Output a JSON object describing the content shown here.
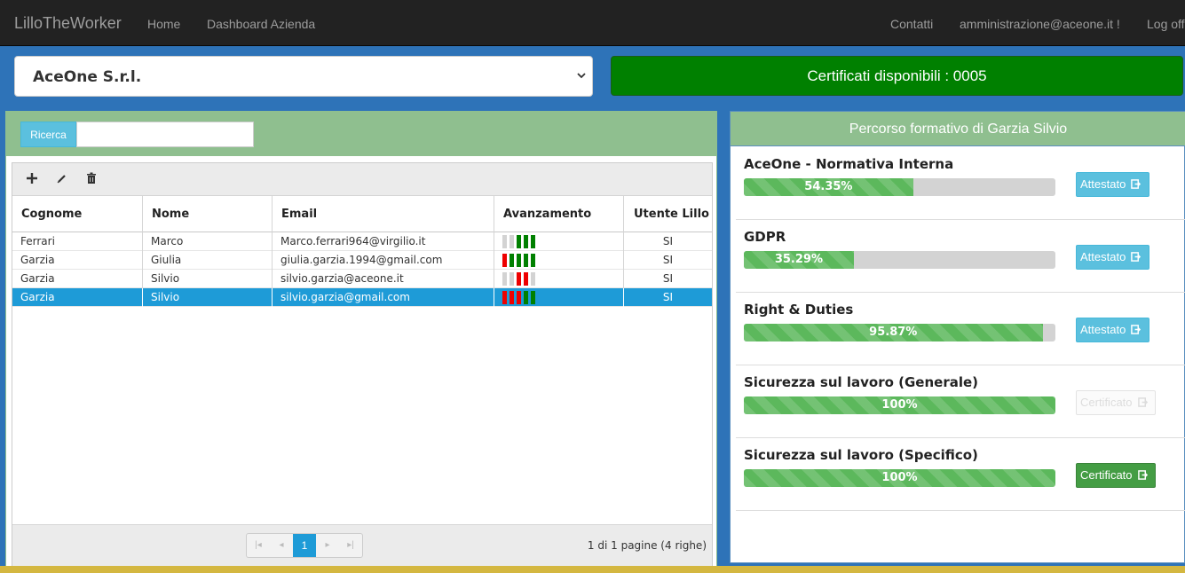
{
  "navbar": {
    "brand": "LilloTheWorker",
    "links": [
      "Home",
      "Dashboard Azienda"
    ],
    "right_links": [
      "Contatti",
      "amministrazione@aceone.it !",
      "Log off"
    ]
  },
  "company_select": {
    "value": "AceOne S.r.l."
  },
  "certificates": {
    "label": "Certificati disponibili : 0005"
  },
  "search": {
    "button_label": "Ricerca",
    "value": ""
  },
  "toolbar": {
    "icons": [
      "plus-icon",
      "pencil-icon",
      "trash-icon"
    ]
  },
  "table": {
    "columns": [
      "Cognome",
      "Nome",
      "Email",
      "Avanzamento",
      "Utente Lillo"
    ],
    "rows": [
      {
        "cognome": "Ferrari",
        "nome": "Marco",
        "email": "Marco.ferrari964@virgilio.it",
        "avanzamento": [
          "grey",
          "grey",
          "green",
          "green",
          "green"
        ],
        "utente": "SI"
      },
      {
        "cognome": "Garzia",
        "nome": "Giulia",
        "email": "giulia.garzia.1994@gmail.com",
        "avanzamento": [
          "red",
          "green",
          "green",
          "green",
          "green"
        ],
        "utente": "SI"
      },
      {
        "cognome": "Garzia",
        "nome": "Silvio",
        "email": "silvio.garzia@aceone.it",
        "avanzamento": [
          "grey",
          "grey",
          "red",
          "red",
          "grey"
        ],
        "utente": "SI"
      },
      {
        "cognome": "Garzia",
        "nome": "Silvio",
        "email": "silvio.garzia@gmail.com",
        "avanzamento": [
          "red",
          "red",
          "red",
          "green",
          "green"
        ],
        "utente": "SI",
        "selected": true
      }
    ]
  },
  "pagination": {
    "current_page": "1",
    "info": "1 di 1 pagine (4 righe)"
  },
  "right_panel": {
    "title": "Percorso formativo di Garzia Silvio",
    "courses": [
      {
        "title": "AceOne - Normativa Interna",
        "progress": 54.35,
        "progress_label": "54.35%",
        "button": "Attestato",
        "button_state": "info"
      },
      {
        "title": "GDPR",
        "progress": 35.29,
        "progress_label": "35.29%",
        "button": "Attestato",
        "button_state": "info"
      },
      {
        "title": "Right & Duties",
        "progress": 95.87,
        "progress_label": "95.87%",
        "button": "Attestato",
        "button_state": "info"
      },
      {
        "title": "Sicurezza sul lavoro (Generale)",
        "progress": 100,
        "progress_label": "100%",
        "button": "Certificato",
        "button_state": "disabled"
      },
      {
        "title": "Sicurezza sul lavoro (Specifico)",
        "progress": 100,
        "progress_label": "100%",
        "button": "Certificato",
        "button_state": "success"
      }
    ]
  },
  "colors": {
    "navbar": "#222222",
    "page_bg": "#2e73b8",
    "panel_header": "#8fbf8f",
    "cert_green": "#008000",
    "selected_row": "#1e9bd7",
    "bar_green": "#008000",
    "bar_red": "#ee0000",
    "bar_grey": "#d3d3d3"
  }
}
